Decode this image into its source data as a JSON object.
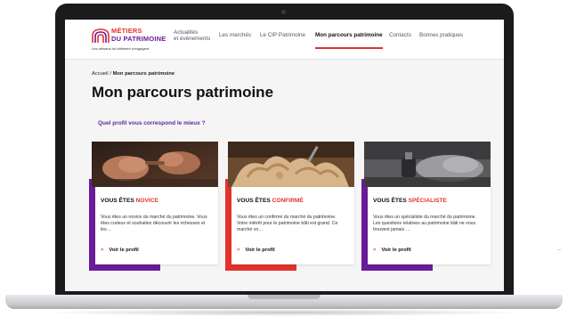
{
  "site": {
    "logo_line1": "MÉTIERS",
    "logo_line2": "DU PATRIMOINE",
    "logo_tagline": "Les artisans du bâtiment s'engagent",
    "accent_red": "#e4322b",
    "accent_purple": "#6a1b9a"
  },
  "nav": {
    "items": [
      {
        "label_line1": "Actualités",
        "label_line2": "et évènements"
      },
      {
        "label": "Les marchés"
      },
      {
        "label": "Le CIP Patrimoine"
      },
      {
        "label": "Mon parcours patrimoine",
        "active": true
      },
      {
        "label": "Contacts"
      },
      {
        "label": "Bonnes pratiques"
      }
    ]
  },
  "breadcrumb": {
    "home": "Accueil",
    "separator": "/",
    "current": "Mon parcours patrimoine"
  },
  "page": {
    "title": "Mon parcours patrimoine",
    "question": "Quel profil vous correspond le mieux ?"
  },
  "cards": [
    {
      "prefix": "VOUS ÊTES ",
      "profile": "NOVICE",
      "text": "Vous êtes un novice du marché du patrimoine. Vous êtes curieux et souhaitez découvrir les richesses et les…",
      "link": "Voir le profil",
      "accent_color": "#6a1b9a",
      "photo": "hands-carving-wood"
    },
    {
      "prefix": "VOUS ÊTES ",
      "profile": "CONFIRMÉ",
      "text": "Vous êtes un confirmé du marché du patrimoine. Votre intérêt pour le patrimoine bâti est grand. Ce marché vo…",
      "link": "Voir le profil",
      "accent_color": "#e4322b",
      "photo": "wood-sculpture-ornament"
    },
    {
      "prefix": "VOUS ÊTES ",
      "profile": "SPÉCIALISTE",
      "text": "Vous êtes un spécialiste du marché du patrimoine. Les questions relatives au patrimoine bâti ne vous trouvent jamais …",
      "link": "Voir le profil",
      "accent_color": "#6a1b9a",
      "photo": "craftsman-hand-tool"
    }
  ]
}
